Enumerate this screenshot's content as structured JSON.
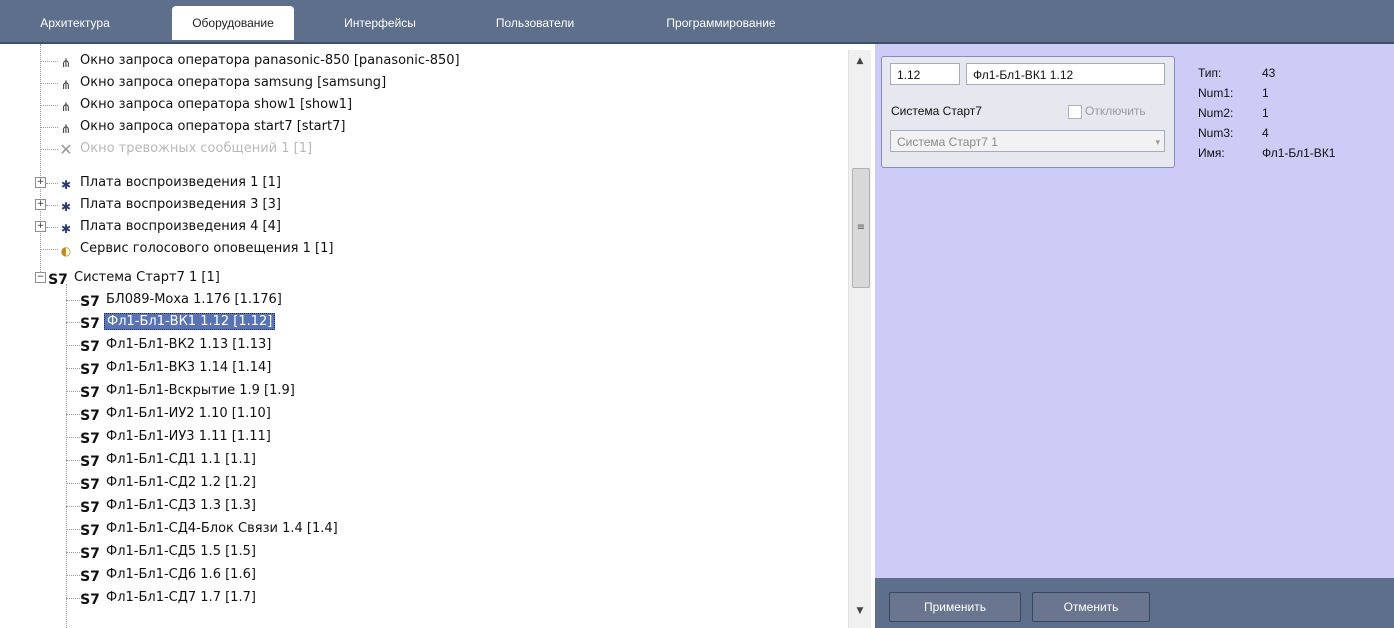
{
  "tabs": [
    {
      "label": "Архитектура"
    },
    {
      "label": "Оборудование"
    },
    {
      "label": "Интерфейсы"
    },
    {
      "label": "Пользователи"
    },
    {
      "label": "Программирование"
    }
  ],
  "tree": {
    "items": [
      {
        "label": "Окно запроса оператора panasonic-850 [panasonic-850]",
        "icon": "operator-request-icon"
      },
      {
        "label": "Окно запроса оператора samsung [samsung]",
        "icon": "operator-request-icon"
      },
      {
        "label": "Окно запроса оператора show1 [show1]",
        "icon": "operator-request-icon"
      },
      {
        "label": "Окно запроса оператора start7 [start7]",
        "icon": "operator-request-icon"
      },
      {
        "label": "Окно тревожных сообщений 1 [1]",
        "icon": "disabled-x-icon"
      },
      {
        "label": "Плата воспроизведения 1 [1]",
        "icon": "playback-board-icon"
      },
      {
        "label": "Плата воспроизведения 3 [3]",
        "icon": "playback-board-icon"
      },
      {
        "label": "Плата воспроизведения 4 [4]",
        "icon": "playback-board-icon"
      },
      {
        "label": "Сервис голосового оповещения 1 [1]",
        "icon": "voice-notification-icon"
      },
      {
        "label": "Система Старт7 1 [1]",
        "icon": "s7-icon"
      },
      {
        "label": "БЛ089-Моха 1.176 [1.176]",
        "icon": "s7-icon"
      },
      {
        "label": "Фл1-Бл1-ВК1 1.12 [1.12]",
        "icon": "s7-icon"
      },
      {
        "label": "Фл1-Бл1-ВК2 1.13 [1.13]",
        "icon": "s7-icon"
      },
      {
        "label": "Фл1-Бл1-ВК3 1.14 [1.14]",
        "icon": "s7-icon"
      },
      {
        "label": "Фл1-Бл1-Вскрытие 1.9 [1.9]",
        "icon": "s7-icon"
      },
      {
        "label": "Фл1-Бл1-ИУ2 1.10 [1.10]",
        "icon": "s7-icon"
      },
      {
        "label": "Фл1-Бл1-ИУ3 1.11 [1.11]",
        "icon": "s7-icon"
      },
      {
        "label": "Фл1-Бл1-СД1 1.1 [1.1]",
        "icon": "s7-icon"
      },
      {
        "label": "Фл1-Бл1-СД2 1.2 [1.2]",
        "icon": "s7-icon"
      },
      {
        "label": "Фл1-Бл1-СД3 1.3 [1.3]",
        "icon": "s7-icon"
      },
      {
        "label": "Фл1-Бл1-СД4-Блок Связи 1.4 [1.4]",
        "icon": "s7-icon"
      },
      {
        "label": "Фл1-Бл1-СД5 1.5 [1.5]",
        "icon": "s7-icon"
      },
      {
        "label": "Фл1-Бл1-СД6 1.6 [1.6]",
        "icon": "s7-icon"
      },
      {
        "label": "Фл1-Бл1-СД7 1.7 [1.7]",
        "icon": "s7-icon"
      }
    ],
    "icon_text": {
      "s7": "S7",
      "op": "⋔",
      "x": "✕",
      "board": "✱",
      "sound": "◐"
    },
    "expander_plus": "+",
    "expander_minus": "−"
  },
  "scrollbar": {
    "up": "▲",
    "down": "▼",
    "grip": "≡"
  },
  "props": {
    "id_value": "1.12",
    "name_value": "Фл1-Бл1-ВК1 1.12",
    "system_label": "Система Старт7",
    "disable_label": "Отключить",
    "system_select": "Система Старт7 1",
    "select_arrow": "▾"
  },
  "info": {
    "type_label": "Тип:",
    "type_value": "43",
    "num1_label": "Num1:",
    "num1_value": "1",
    "num2_label": "Num2:",
    "num2_value": "1",
    "num3_label": "Num3:",
    "num3_value": "4",
    "name_label": "Имя:",
    "name_value": "Фл1-Бл1-ВК1"
  },
  "buttons": {
    "apply": "Применить",
    "cancel": "Отменить"
  },
  "colors": {
    "tabbar": "#5e6f8b",
    "panel": "#ccccf6",
    "selection": "#5a74b3"
  }
}
